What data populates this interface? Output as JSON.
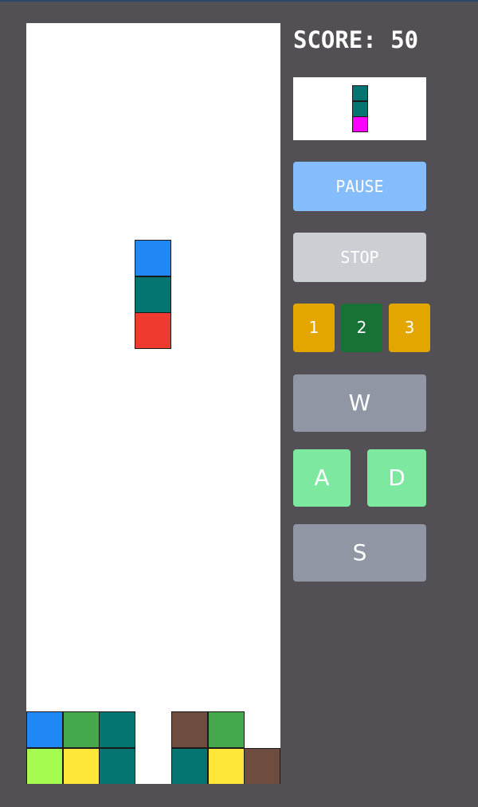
{
  "score": {
    "label": "SCORE: 50"
  },
  "controls": {
    "pause_label": "PAUSE",
    "stop_label": "STOP",
    "levels": [
      "1",
      "2",
      "3"
    ],
    "selected_level": "2",
    "up_label": "W",
    "left_label": "A",
    "right_label": "D",
    "down_label": "S"
  },
  "colors": {
    "background": "#525054",
    "board": "#ffffff",
    "pause": "#85bcfc",
    "stop": "#cbced3",
    "level_inactive": "#e3a500",
    "level_active": "#197235",
    "wasd_grey": "#9196a4",
    "wasd_green": "#7de8a0",
    "blue": "#2088f5",
    "teal": "#057571",
    "red": "#ef3a30",
    "green": "#46a84c",
    "lime": "#a6fb50",
    "yellow": "#ffe739",
    "brown": "#6e4c3e",
    "magenta": "#fe00ff"
  },
  "board": {
    "columns": 7,
    "rows": 21,
    "falling_piece": [
      "blue",
      "teal",
      "red"
    ],
    "settled": [
      [
        null,
        null,
        null,
        null,
        null,
        null,
        null
      ],
      [
        null,
        null,
        null,
        null,
        null,
        null,
        null
      ],
      [
        null,
        null,
        null,
        null,
        null,
        null,
        null
      ],
      [
        null,
        null,
        null,
        null,
        null,
        null,
        null
      ],
      [
        null,
        null,
        null,
        null,
        null,
        null,
        null
      ],
      [
        null,
        null,
        null,
        null,
        null,
        null,
        null
      ],
      [
        null,
        null,
        null,
        null,
        null,
        null,
        null
      ],
      [
        null,
        null,
        null,
        null,
        null,
        null,
        null
      ],
      [
        null,
        null,
        null,
        null,
        null,
        null,
        null
      ],
      [
        null,
        null,
        null,
        null,
        null,
        null,
        null
      ],
      [
        null,
        null,
        null,
        null,
        null,
        null,
        null
      ],
      [
        null,
        null,
        null,
        null,
        null,
        null,
        null
      ],
      [
        null,
        null,
        null,
        null,
        null,
        null,
        null
      ],
      [
        null,
        null,
        null,
        null,
        null,
        null,
        null
      ],
      [
        null,
        null,
        null,
        null,
        null,
        null,
        null
      ],
      [
        null,
        null,
        null,
        null,
        null,
        null,
        null
      ],
      [
        null,
        null,
        null,
        null,
        null,
        null,
        null
      ],
      [
        null,
        null,
        null,
        null,
        null,
        null,
        null
      ],
      [
        null,
        null,
        null,
        null,
        null,
        null,
        null
      ],
      [
        "blue",
        "green",
        "teal",
        null,
        "brown",
        "green",
        null
      ],
      [
        "lime",
        "yellow",
        "teal",
        null,
        "teal",
        "yellow",
        "brown"
      ]
    ]
  },
  "next_piece": [
    "teal",
    "teal",
    "magenta"
  ]
}
